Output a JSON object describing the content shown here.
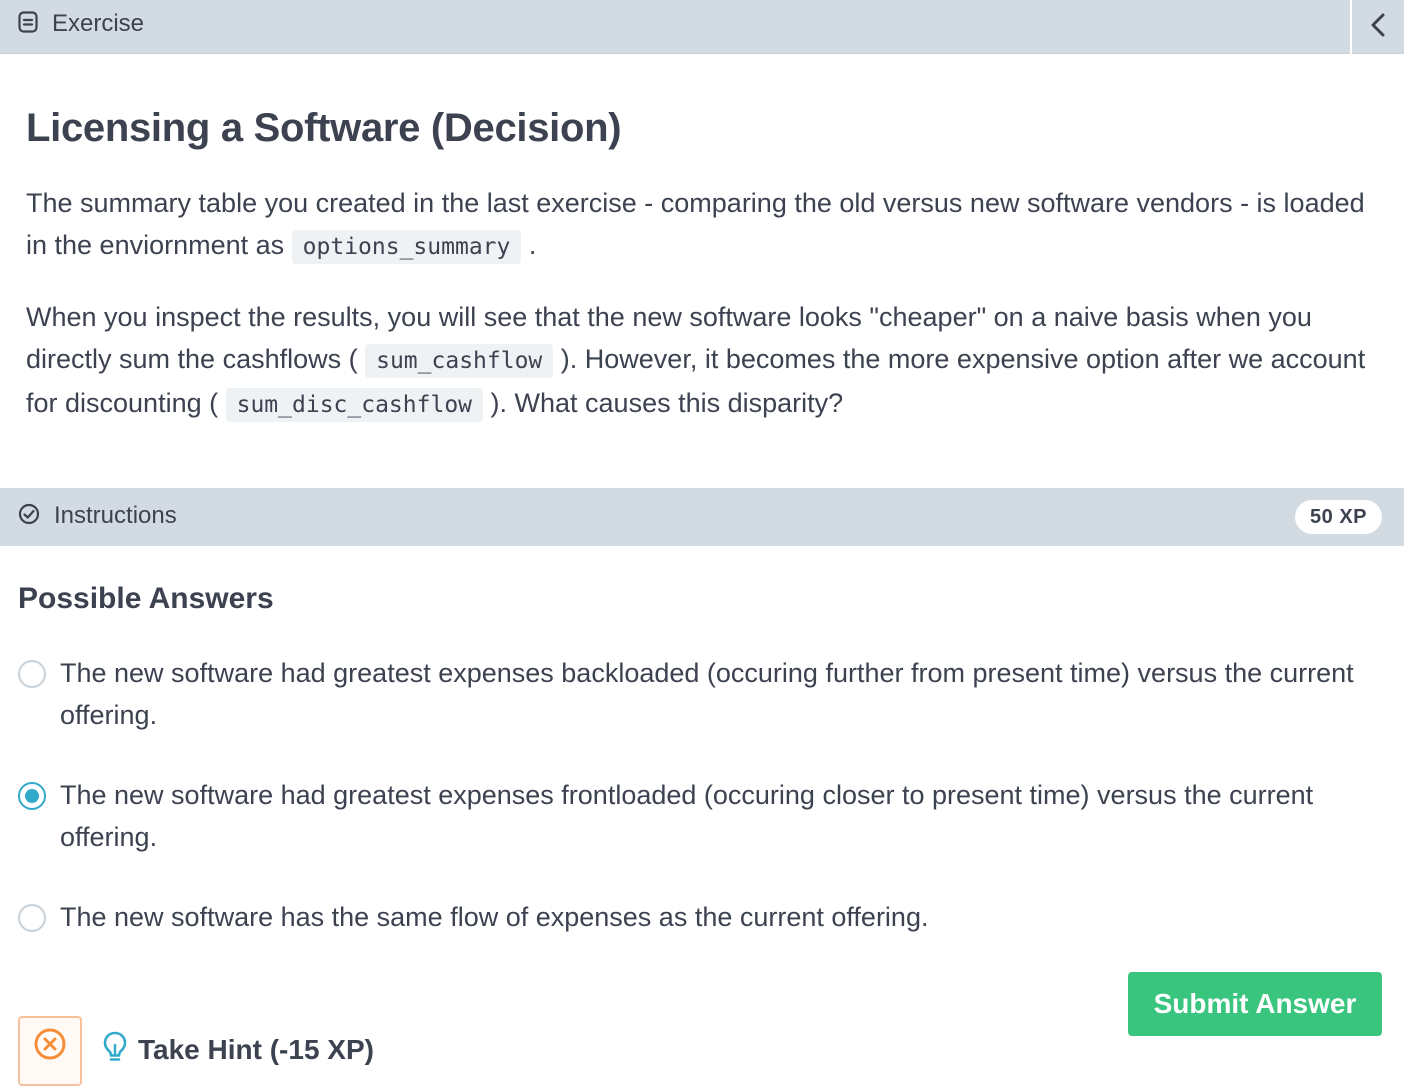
{
  "header": {
    "icon": "document-icon",
    "title": "Exercise",
    "collapse_icon": "chevron-left-icon"
  },
  "exercise": {
    "title": "Licensing a Software (Decision)",
    "p1_before": "The summary table you created in the last exercise - comparing the old versus new software vendors - is loaded in the enviornment as ",
    "p1_code": "options_summary",
    "p1_after": " .",
    "p2_a": "When you inspect the results, you will see that the new software looks \"cheaper\" on a naive basis when you directly sum the cashflows ( ",
    "p2_code1": "sum_cashflow",
    "p2_b": " ). However, it becomes the more expensive option after we account for discounting ( ",
    "p2_code2": "sum_disc_cashflow",
    "p2_c": " ). What causes this disparity?"
  },
  "instructions": {
    "icon": "check-circle-icon",
    "label": "Instructions",
    "xp": "50 XP"
  },
  "answers": {
    "title": "Possible Answers",
    "options": [
      {
        "text": "The new software had greatest expenses backloaded (occuring further from present time) versus the current offering.",
        "selected": false
      },
      {
        "text": "The new software had greatest expenses frontloaded (occuring closer to present time) versus the current offering.",
        "selected": true
      },
      {
        "text": "The new software has the same flow of expenses as the current offering.",
        "selected": false
      }
    ]
  },
  "actions": {
    "submit_label": "Submit Answer",
    "hint_label": "Take Hint (-15 XP)",
    "hint_icon": "lightbulb-icon",
    "dismiss_icon": "close-circle-icon"
  },
  "colors": {
    "header_bg": "#d1dbe1",
    "text": "#3d4251",
    "accent_blue": "#33aacc",
    "submit_green": "#3ac57e",
    "warning_orange": "#f58e3a"
  }
}
